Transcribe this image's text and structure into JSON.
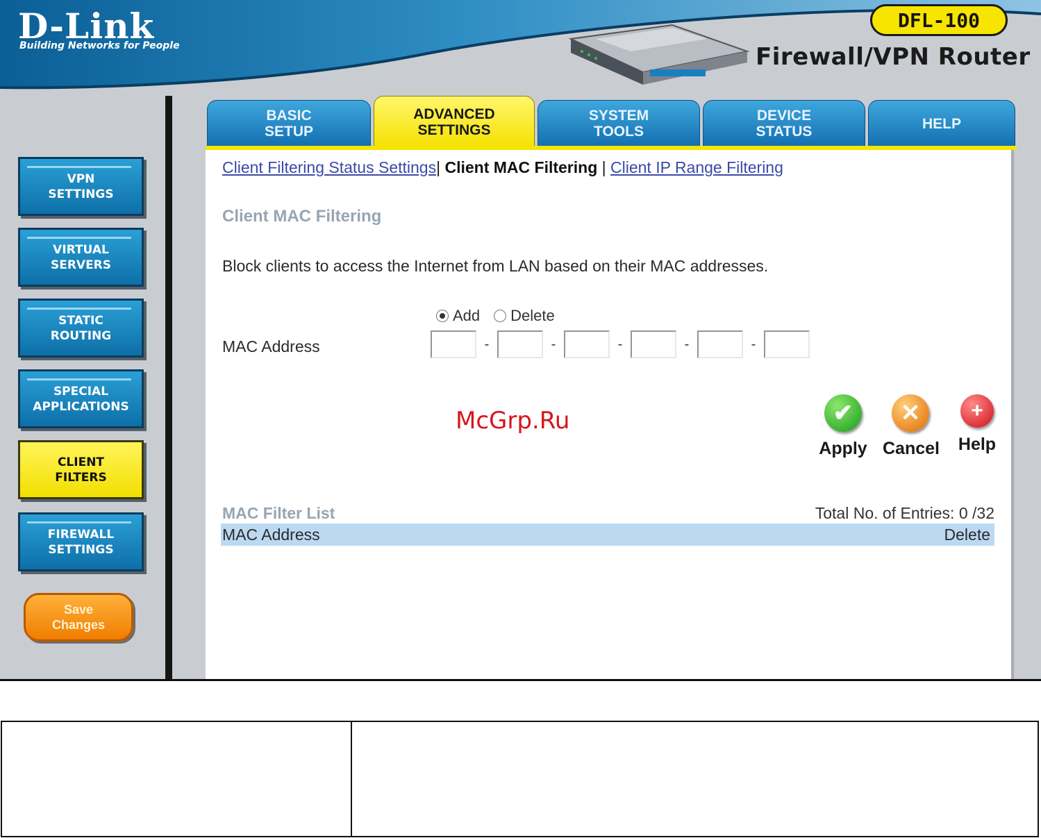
{
  "header": {
    "logo": "D-Link",
    "tagline": "Building Networks for People",
    "model": "DFL-100",
    "product": "Firewall/VPN Router"
  },
  "tabs": [
    {
      "label": "BASIC\nSETUP",
      "active": false
    },
    {
      "label": "ADVANCED\nSETTINGS",
      "active": true
    },
    {
      "label": "SYSTEM\nTOOLS",
      "active": false
    },
    {
      "label": "DEVICE\nSTATUS",
      "active": false
    },
    {
      "label": "HELP",
      "active": false
    }
  ],
  "sidebar": {
    "items": [
      {
        "label": "VPN\nSETTINGS",
        "active": false
      },
      {
        "label": "VIRTUAL\nSERVERS",
        "active": false
      },
      {
        "label": "STATIC\nROUTING",
        "active": false
      },
      {
        "label": "SPECIAL\nAPPLICATIONS",
        "active": false
      },
      {
        "label": "CLIENT\nFILTERS",
        "active": true
      },
      {
        "label": "FIREWALL\nSETTINGS",
        "active": false
      }
    ],
    "save_label": "Save\nChanges"
  },
  "subnav": {
    "link1": "Client Filtering Status Settings",
    "current": "Client MAC Filtering",
    "link2": "Client IP Range Filtering",
    "sep1": "|",
    "sep2": "|"
  },
  "main": {
    "section_title": "Client MAC Filtering",
    "description": "Block clients to access the Internet from LAN based on their MAC addresses.",
    "radio_add": "Add",
    "radio_delete": "Delete",
    "radio_selected": "Add",
    "mac_label": "MAC Address",
    "mac_octets": [
      "",
      "",
      "",
      "",
      "",
      ""
    ],
    "mac_separator": "-"
  },
  "actions": {
    "apply": "Apply",
    "cancel": "Cancel",
    "help": "Help"
  },
  "list": {
    "title": "MAC Filter List",
    "total": "Total No. of Entries: 0 /32",
    "col_mac": "MAC Address",
    "col_delete": "Delete"
  },
  "watermark": "McGrp.Ru",
  "colors": {
    "accent_blue": "#1580c0",
    "active_yellow": "#f5e100",
    "save_orange": "#f07d00"
  }
}
